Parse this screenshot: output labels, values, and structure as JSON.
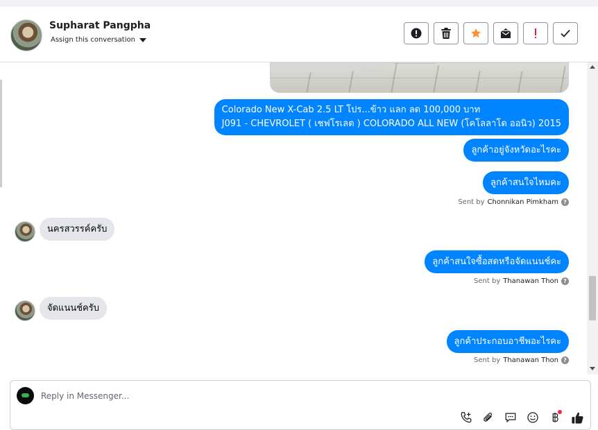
{
  "header": {
    "contact_name": "Supharat Pangpha",
    "assign_label": "Assign this conversation",
    "toolbar": [
      {
        "name": "mark-spam-button",
        "icon": "alert-circle-icon"
      },
      {
        "name": "delete-button",
        "icon": "trash-icon"
      },
      {
        "name": "star-button",
        "icon": "star-icon"
      },
      {
        "name": "mark-unread-button",
        "icon": "envelope-icon"
      },
      {
        "name": "follow-up-button",
        "icon": "exclamation-icon"
      },
      {
        "name": "mark-done-button",
        "icon": "checkmark-icon"
      }
    ]
  },
  "messages": [
    {
      "type": "out",
      "lines": [
        "Colorado New X-Cab 2.5 LT โปร...ข้าว แลก ลด 100,000 บาท",
        "J091 - CHEVROLET ( เชฟโรเลต ) COLORADO ALL NEW (โคโลลาโด ออนิว) 2015"
      ]
    },
    {
      "type": "out",
      "text": "ลูกค้าอยู่จังหวัดอะไรคะ"
    },
    {
      "type": "out",
      "text": "ลูกค้าสนใจไหมคะ"
    },
    {
      "type": "sent",
      "prefix": "Sent by",
      "name": "Chonnikan Pimkham"
    },
    {
      "type": "in",
      "text": "นครสวรรค์ครับ"
    },
    {
      "type": "out",
      "text": "ลูกค้าสนใจซื้อสดหรือจัดแนนช์คะ"
    },
    {
      "type": "sent",
      "prefix": "Sent by",
      "name": "Thanawan Thon"
    },
    {
      "type": "in",
      "text": "จัดแนนช์ครับ"
    },
    {
      "type": "out",
      "text": "ลูกค้าประกอบอาชีพอะไรคะ"
    },
    {
      "type": "sent",
      "prefix": "Sent by",
      "name": "Thanawan Thon"
    }
  ],
  "reply": {
    "placeholder": "Reply in Messenger...",
    "icons": [
      "add-call-icon",
      "attachment-icon",
      "saved-replies-icon",
      "emoji-icon",
      "payment-icon",
      "like-icon"
    ]
  },
  "colors": {
    "outgoing_bubble": "#0084ff",
    "incoming_bubble": "#e4e6eb",
    "star_accent": "#f7923a",
    "followup_accent": "#e41e3f"
  }
}
